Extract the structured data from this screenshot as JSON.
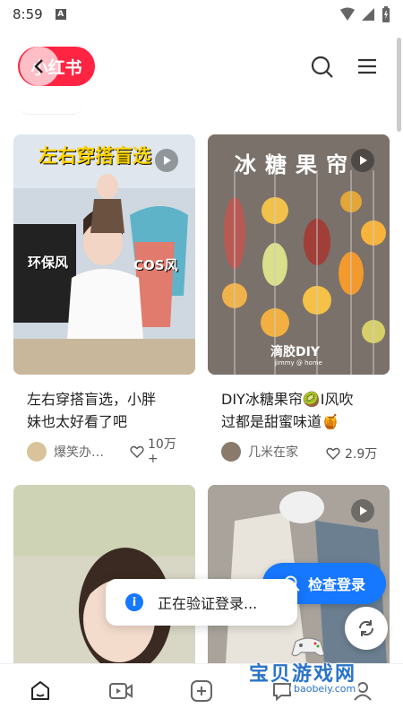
{
  "status_bar": {
    "time": "8:59",
    "indicator": "A"
  },
  "header": {
    "logo_text": "小红书"
  },
  "feed": {
    "cards": [
      {
        "title_line1": "左右穿搭盲选，小胖",
        "title_line2": "妹也太好看了吧",
        "author": "爆笑办…",
        "likes_line1": "10万",
        "likes_line2": "+",
        "overlay_title": "左右穿搭盲选",
        "overlay_left": "环保风",
        "overlay_right": "COS风"
      },
      {
        "title_line1": "DIY冰糖果帘🥝I风吹",
        "title_line2": "过都是甜蜜味道🍯",
        "author": "几米在家",
        "likes": "2.9万",
        "overlay_title": "冰糖果帘",
        "overlay_caption": "滴胶DIY",
        "overlay_small": "jimmy @ home"
      }
    ]
  },
  "check_login_label": "检查登录",
  "toast_text": "正在验证登录...",
  "watermark": {
    "text": "宝贝游戏网",
    "url": "baobeiy.com"
  },
  "colors": {
    "brand": "#ff2442",
    "accent": "#1677ff"
  }
}
